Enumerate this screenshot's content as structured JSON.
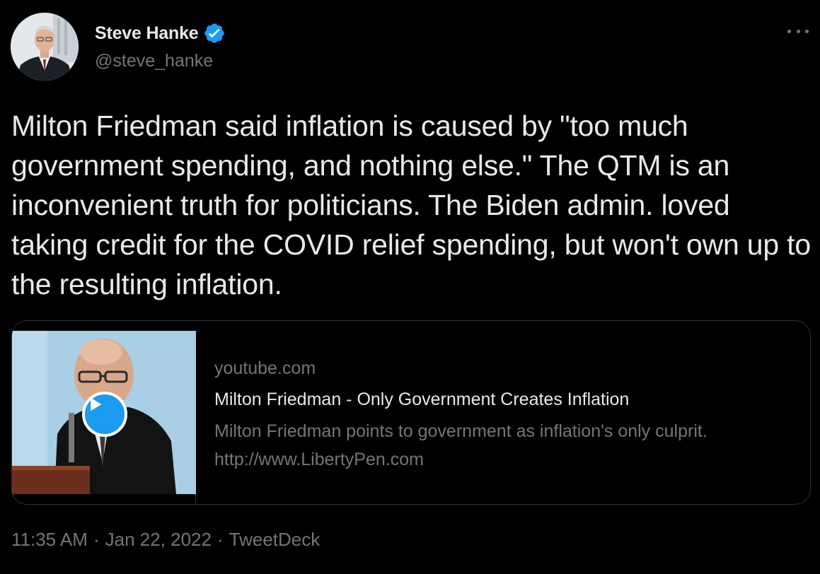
{
  "author": {
    "name": "Steve Hanke",
    "handle": "@steve_hanke",
    "verified": true,
    "avatar_icon": "profile-photo"
  },
  "more_icon": "more-horizontal-icon",
  "tweet": {
    "text": "Milton Friedman said inflation is caused by \"too much government spending, and nothing else.\" The QTM is an inconvenient truth for politicians. The Biden admin. loved taking credit for the COVID relief spending, but won't own up to the resulting inflation."
  },
  "card": {
    "domain": "youtube.com",
    "title": "Milton Friedman - Only Government Creates Inflation",
    "description": "Milton Friedman points to government as inflation's only culprit. http://www.LibertyPen.com",
    "play_icon": "play-icon"
  },
  "meta": {
    "time": "11:35 AM",
    "date": "Jan 22, 2022",
    "source": "TweetDeck",
    "separator": "·"
  },
  "colors": {
    "background": "#000000",
    "text_primary": "#e7e9ea",
    "text_secondary": "#71767b",
    "border": "#2f3336",
    "accent": "#1d9bf0"
  }
}
